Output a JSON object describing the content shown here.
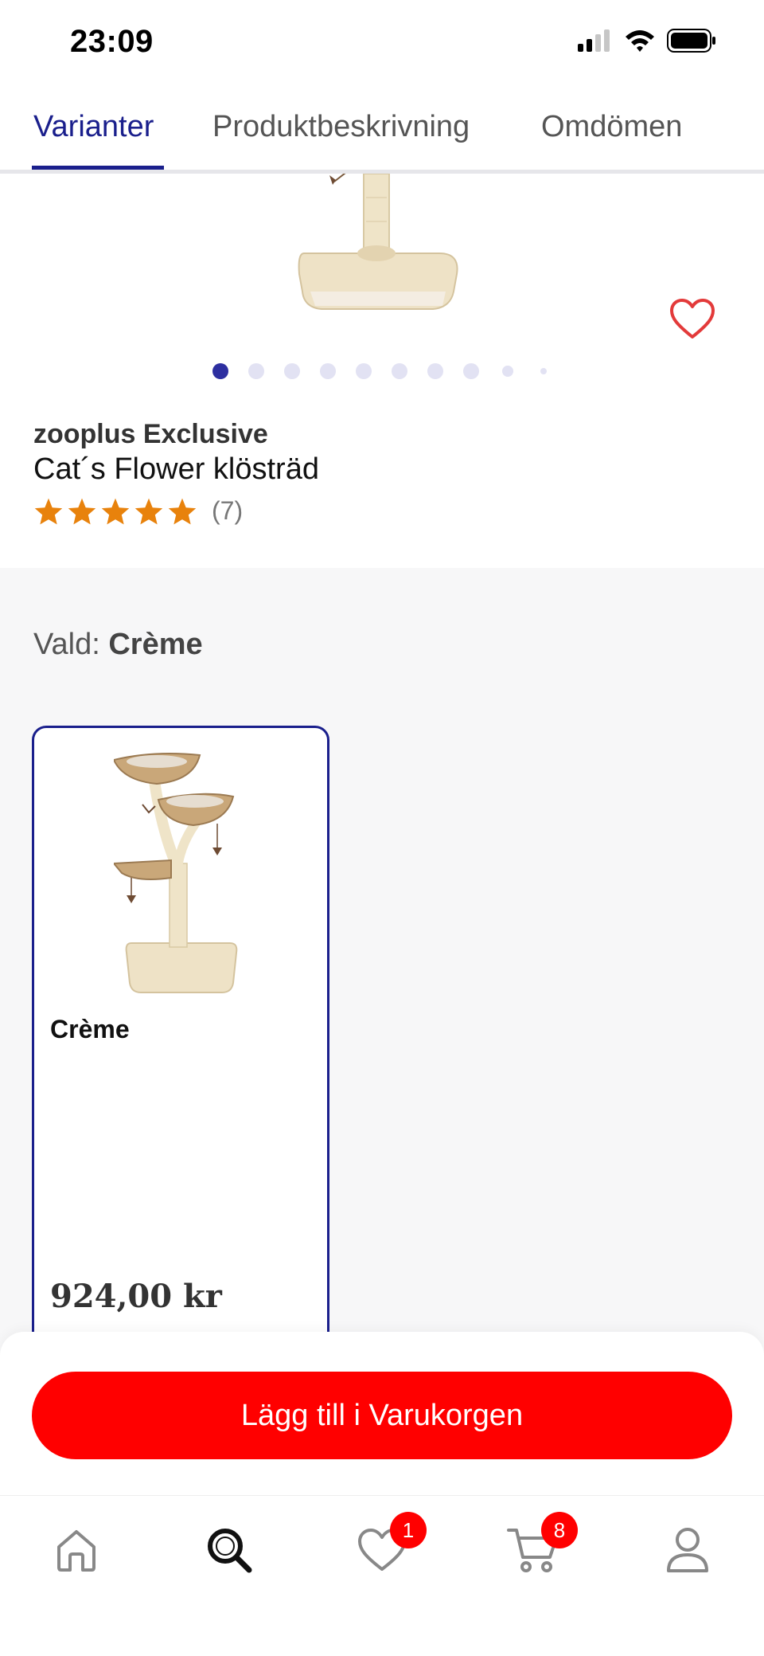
{
  "status_bar": {
    "time": "23:09"
  },
  "tabs": [
    {
      "label": "Varianter",
      "active": true
    },
    {
      "label": "Produktbeskrivning",
      "active": false
    },
    {
      "label": "Omdömen",
      "active": false
    }
  ],
  "product": {
    "brand": "zooplus Exclusive",
    "name": "Cat´s Flower klösträd",
    "rating_stars": 5,
    "rating_count": "(7)",
    "image_dots_total": 10,
    "image_dots_active": 1
  },
  "variants": {
    "selected_label": "Vald:",
    "selected_value": "Crème",
    "items": [
      {
        "name": "Crème",
        "price": "924,00 kr",
        "selected": true
      }
    ]
  },
  "cart_button": {
    "label": "Lägg till i Varukorgen"
  },
  "bottom_nav": {
    "items": [
      {
        "name": "home",
        "icon": "home-icon"
      },
      {
        "name": "search",
        "icon": "search-icon",
        "active": true
      },
      {
        "name": "wishlist",
        "icon": "heart-icon",
        "badge": "1"
      },
      {
        "name": "cart",
        "icon": "cart-icon",
        "badge": "8"
      },
      {
        "name": "account",
        "icon": "user-icon"
      }
    ]
  },
  "colors": {
    "accent": "#1a1f8c",
    "cta": "#ff0000",
    "star": "#e8820c",
    "heart": "#e33a3a"
  }
}
